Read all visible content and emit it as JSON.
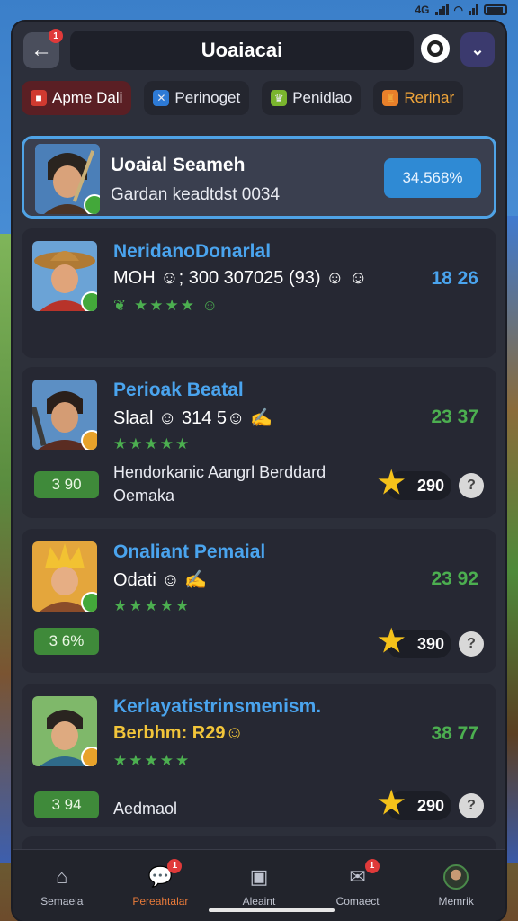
{
  "status_bar": {
    "network": "4G"
  },
  "header": {
    "title": "Uoaiacai",
    "back_badge": "1",
    "icons": [
      "back-arrow-icon",
      "circle-icon",
      "chevron-down-icon"
    ]
  },
  "tabs": [
    {
      "label": "Apme Dali",
      "icon": "shield-icon"
    },
    {
      "label": "Perinoget",
      "icon": "swords-icon"
    },
    {
      "label": "Penidlao",
      "icon": "crown-icon"
    },
    {
      "label": "Rerinar",
      "icon": "trophy-icon"
    }
  ],
  "highlight": {
    "name": "Uoaial Seameh",
    "subtitle": "Gardan keadtdst 0034",
    "percent": "34.568%"
  },
  "cards": [
    {
      "name": "NeridanoDonarlal",
      "line2": "MOH ☺; 300 307025 (93) ☺ ☺",
      "score": "18 26",
      "stars": "❦ ★★★★ ☺"
    },
    {
      "name": "Perioak Beatal",
      "line2": "Slaal ☺ 314 5☺ ✍",
      "score": "23 37",
      "stars": "★★★★★",
      "desc": "Hendorkanic Aangrl Berddard Oemaka",
      "badge": "3 90",
      "points": "290"
    },
    {
      "name": "Onaliant Pemaial",
      "line2": "Odati ☺ ✍",
      "score": "23 92",
      "stars": "★★★★★",
      "badge": "3 6%",
      "points": "390"
    },
    {
      "name": "Kerlayatistrinsmenism.",
      "line2": "Berbhm: R29☺",
      "score": "38 77",
      "stars": "★★★★★",
      "desc": "Aedmaol",
      "badge": "3 94",
      "points": "290"
    }
  ],
  "bottom_nav": [
    {
      "label": "Semaeia",
      "icon": "home-icon"
    },
    {
      "label": "Pereahtalar",
      "icon": "chat-icon",
      "badge": "1"
    },
    {
      "label": "Aleaint",
      "icon": "card-icon"
    },
    {
      "label": "Comaect",
      "icon": "mail-icon",
      "badge": "1"
    },
    {
      "label": "Memrik",
      "icon": "avatar-icon"
    }
  ]
}
